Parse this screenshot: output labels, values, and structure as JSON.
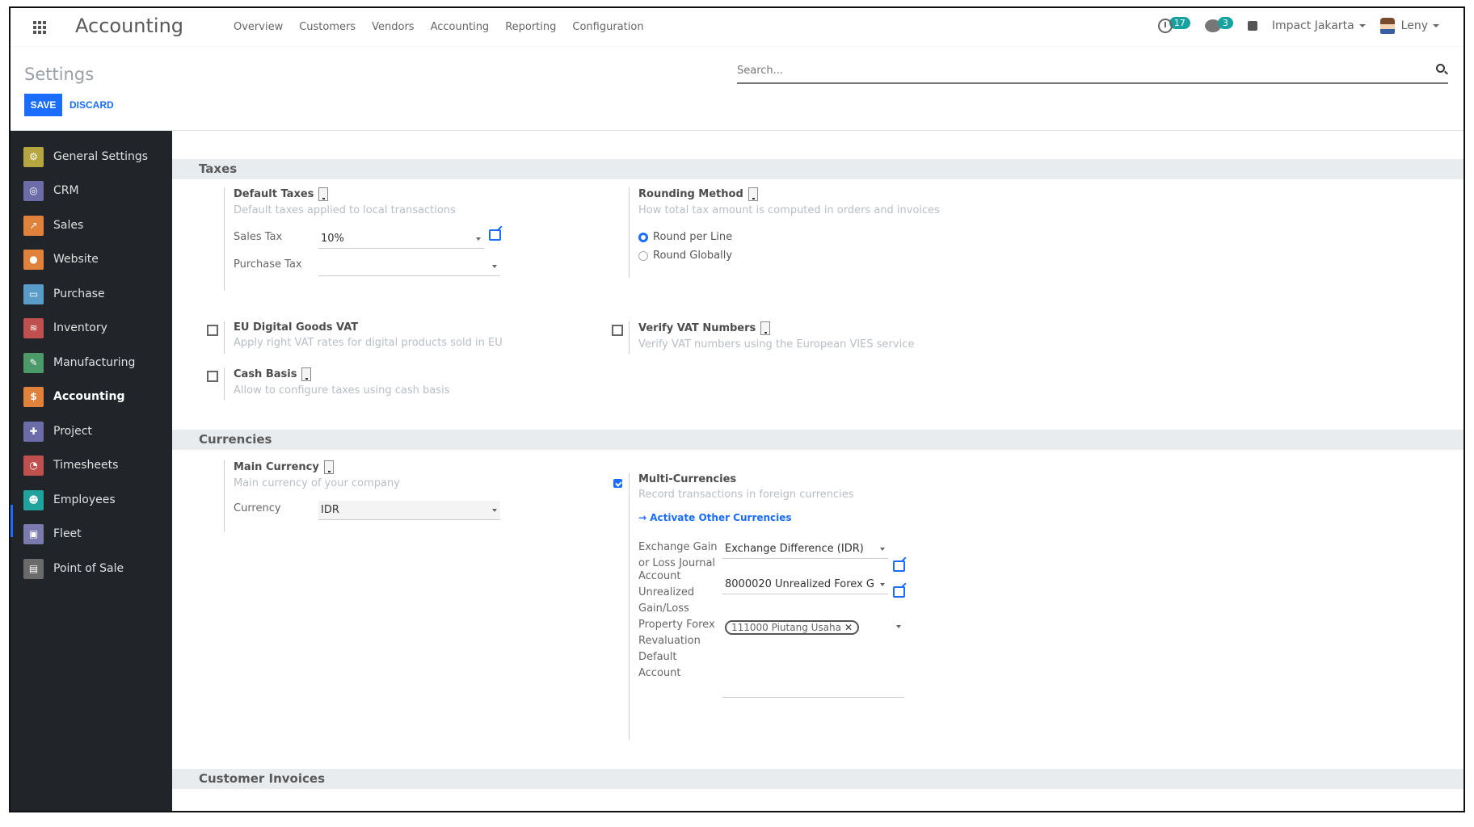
{
  "navbar": {
    "app_title": "Accounting",
    "menu": [
      "Overview",
      "Customers",
      "Vendors",
      "Accounting",
      "Reporting",
      "Configuration"
    ],
    "activity_count": "17",
    "messages_count": "3",
    "company": "Impact Jakarta",
    "user": "Leny"
  },
  "control_panel": {
    "title": "Settings",
    "save_label": "SAVE",
    "discard_label": "DISCARD",
    "search_placeholder": "Search..."
  },
  "sidebar": {
    "items": [
      {
        "label": "General Settings",
        "icon": "gear-icon",
        "color": "#b5a642"
      },
      {
        "label": "CRM",
        "icon": "handshake-icon",
        "color": "#6c6ca8"
      },
      {
        "label": "Sales",
        "icon": "chart-icon",
        "color": "#e0823c"
      },
      {
        "label": "Website",
        "icon": "globe-icon",
        "color": "#e0823c"
      },
      {
        "label": "Purchase",
        "icon": "card-icon",
        "color": "#5a9cc8"
      },
      {
        "label": "Inventory",
        "icon": "box-icon",
        "color": "#c0504d"
      },
      {
        "label": "Manufacturing",
        "icon": "wrench-icon",
        "color": "#4c9a6a"
      },
      {
        "label": "Accounting",
        "icon": "invoice-icon",
        "color": "#e0823c"
      },
      {
        "label": "Project",
        "icon": "puzzle-icon",
        "color": "#6c6ca8"
      },
      {
        "label": "Timesheets",
        "icon": "stopwatch-icon",
        "color": "#c0504d"
      },
      {
        "label": "Employees",
        "icon": "users-icon",
        "color": "#1fa39c"
      },
      {
        "label": "Fleet",
        "icon": "car-icon",
        "color": "#7a7aae"
      },
      {
        "label": "Point of Sale",
        "icon": "store-icon",
        "color": "#6a6a6a"
      }
    ],
    "active": "Accounting"
  },
  "sections": {
    "taxes": {
      "title": "Taxes",
      "default_taxes": {
        "title": "Default Taxes",
        "desc": "Default taxes applied to local transactions",
        "sales_tax_label": "Sales Tax",
        "sales_tax_value": "10%",
        "purchase_tax_label": "Purchase Tax",
        "purchase_tax_value": ""
      },
      "rounding": {
        "title": "Rounding Method",
        "desc": "How total tax amount is computed in orders and invoices",
        "options": [
          "Round per Line",
          "Round Globally"
        ],
        "selected": "Round per Line"
      },
      "eu_digital": {
        "title": "EU Digital Goods VAT",
        "desc": "Apply right VAT rates for digital products sold in EU",
        "checked": false
      },
      "verify_vat": {
        "title": "Verify VAT Numbers",
        "desc": "Verify VAT numbers using the European VIES service",
        "checked": false
      },
      "cash_basis": {
        "title": "Cash Basis",
        "desc": "Allow to configure taxes using cash basis",
        "checked": false
      }
    },
    "currencies": {
      "title": "Currencies",
      "main_currency": {
        "title": "Main Currency",
        "desc": "Main currency of your company",
        "currency_label": "Currency",
        "currency_value": "IDR"
      },
      "multi": {
        "title": "Multi-Currencies",
        "desc": "Record transactions in foreign currencies",
        "checked": true,
        "activate_link": "Activate Other Currencies",
        "journal_label": "Exchange Gain or Loss Journal",
        "journal_value": "Exchange Difference (IDR)",
        "account_label": "Account Unrealized Gain/Loss",
        "account_value": "8000020 Unrealized Forex G",
        "property_label": "Property Forex Revaluation Default Account",
        "property_tag": "111000 Piutang Usaha"
      }
    },
    "customer_invoices": {
      "title": "Customer Invoices"
    }
  }
}
